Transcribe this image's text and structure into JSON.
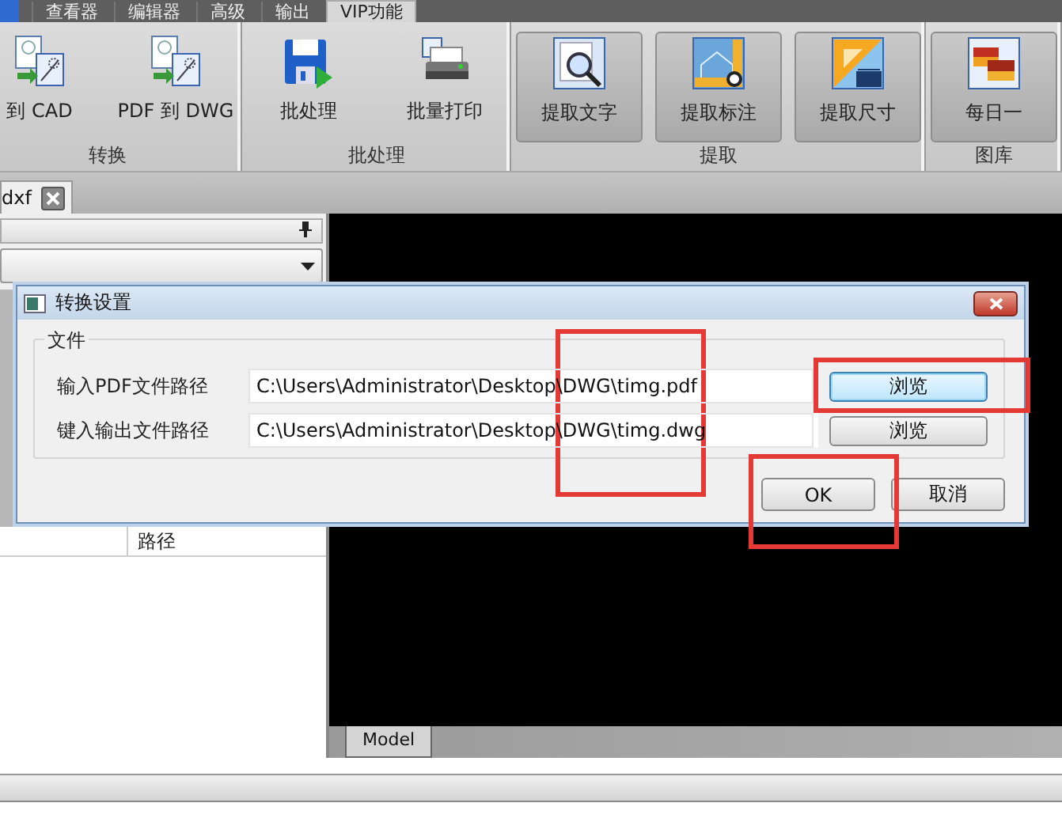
{
  "menu_tabs": [
    {
      "label": "查看器",
      "selected": false
    },
    {
      "label": "编辑器",
      "selected": false
    },
    {
      "label": "高级",
      "selected": false
    },
    {
      "label": "输出",
      "selected": false
    },
    {
      "label": "VIP功能",
      "selected": true
    }
  ],
  "ribbon_groups": [
    {
      "title": "转换",
      "buttons": [
        {
          "label": "到 CAD",
          "raised": false
        },
        {
          "label": "PDF 到 DWG",
          "raised": false
        }
      ]
    },
    {
      "title": "批处理",
      "buttons": [
        {
          "label": "批处理",
          "raised": false
        },
        {
          "label": "批量打印",
          "raised": false
        }
      ]
    },
    {
      "title": "提取",
      "buttons": [
        {
          "label": "提取文字",
          "raised": true
        },
        {
          "label": "提取标注",
          "raised": true
        },
        {
          "label": "提取尺寸",
          "raised": true
        }
      ]
    },
    {
      "title": "图库",
      "buttons": [
        {
          "label": "每日一",
          "raised": true
        }
      ]
    }
  ],
  "document_tabs": [
    {
      "label": "dxf",
      "selected": true
    }
  ],
  "left_panel": {
    "table": {
      "columns": [
        {
          "label": "路径"
        }
      ]
    }
  },
  "canvas": {
    "layout_tabs": [
      {
        "label": "Model",
        "selected": true
      }
    ]
  },
  "dialog": {
    "title": "转换设置",
    "group": "文件",
    "rows": [
      {
        "label": "输入PDF文件路径",
        "value": "C:\\Users\\Administrator\\Desktop\\DWG\\timg.pdf",
        "button": "浏览",
        "focused": true
      },
      {
        "label": "键入输出文件路径",
        "value": "C:\\Users\\Administrator\\Desktop\\DWG\\timg.dwg",
        "button": "浏览",
        "focused": false
      }
    ],
    "buttons": [
      {
        "label": "OK"
      },
      {
        "label": "取消"
      }
    ]
  },
  "annotations": [
    {
      "kind": "path-column"
    },
    {
      "kind": "browse-button"
    },
    {
      "kind": "ok-button"
    }
  ]
}
